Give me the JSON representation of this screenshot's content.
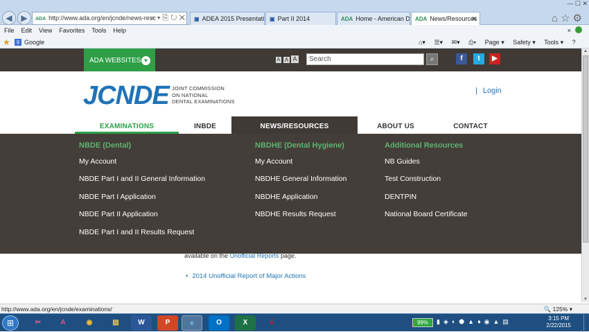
{
  "browser": {
    "address_url": "http://www.ada.org/en/jcnde/news-resc",
    "address_site_icon": "ADA",
    "tabs": [
      {
        "label": "ADEA 2015 Presentatio...",
        "icon": "page-icon"
      },
      {
        "label": "Part II 2014",
        "icon": "page-icon"
      },
      {
        "label": "Home - American Den...",
        "icon": "ADA"
      },
      {
        "label": "News/Resources",
        "icon": "ADA",
        "active": true
      }
    ],
    "menu": [
      "File",
      "Edit",
      "View",
      "Favorites",
      "Tools",
      "Help"
    ],
    "favorites": {
      "google_label": "Google",
      "g_icon": "g"
    },
    "commandbar": {
      "page": "Page ▾",
      "safety": "Safety ▾",
      "tools": "Tools ▾",
      "help": "?"
    },
    "status_url": "http://www.ada.org/en/jcnde/examinations/",
    "zoom": "125%"
  },
  "site": {
    "ada_websites": "ADA WEBSITES",
    "font_sizes": [
      "A",
      "A",
      "A"
    ],
    "search_placeholder": "Search",
    "logo": "JCNDE",
    "logo_sub": [
      "JOINT COMMISSION",
      "ON NATIONAL",
      "DENTAL EXAMINATIONS"
    ],
    "login_separator": "|",
    "login": "Login",
    "nav": {
      "examinations": "EXAMINATIONS",
      "inbde": "INBDE",
      "news": "NEWS/RESOURCES",
      "about": "ABOUT US",
      "contact": "CONTACT"
    },
    "menu_columns": [
      {
        "heading": "NBDE (Dental)",
        "items": [
          "My Account",
          "NBDE Part I and II General Information",
          "NBDE Part I Application",
          "NBDE Part II Application",
          "NBDE Part I and II Results Request"
        ]
      },
      {
        "heading": "NBDHE (Dental Hygiene)",
        "items": [
          "My Account",
          "NBDHE General Information",
          "NBDHE Application",
          "NBDHE Results Request"
        ]
      },
      {
        "heading": "Additional Resources",
        "items": [
          "NB Guides",
          "Test Construction",
          "DENTPIN",
          "National Board Certificate"
        ]
      }
    ],
    "content": {
      "line_prefix": "available on the",
      "line_link": "Unofficial Reports",
      "line_suffix": "page.",
      "report_link": "2014 Unofficial Report of Major Actions"
    },
    "colors": {
      "brand_green": "#2e9e47",
      "brand_blue": "#1f73b7",
      "dark": "#3f3a36"
    }
  },
  "taskbar": {
    "apps": [
      "snipping-tool",
      "acrobat",
      "chrome",
      "explorer",
      "word",
      "powerpoint",
      "internet-explorer",
      "outlook",
      "excel",
      "acrobat-reader"
    ],
    "battery": "99%",
    "clock_time": "3:15 PM",
    "clock_date": "2/22/2015"
  }
}
